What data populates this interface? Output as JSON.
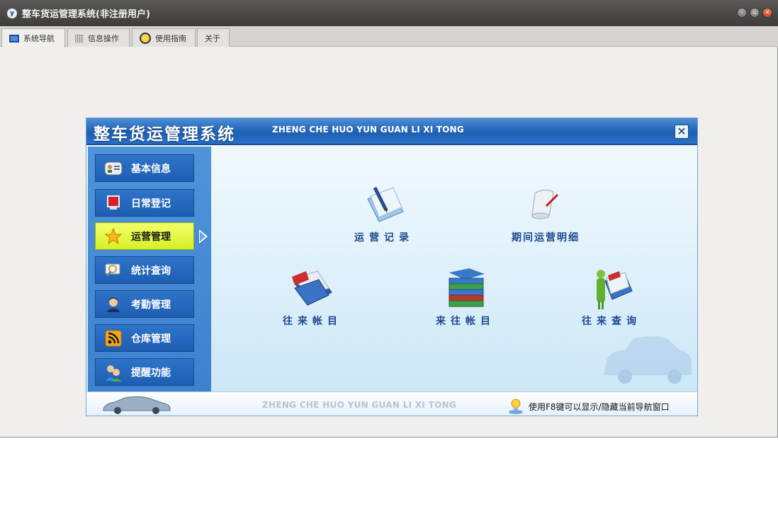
{
  "window": {
    "title": "整车货运管理系统(非注册用户)",
    "app_icon": "y"
  },
  "tabs": [
    {
      "label": "系统导航",
      "icon": "monitor-icon",
      "active": true
    },
    {
      "label": "信息操作",
      "icon": "grid-icon",
      "active": false
    },
    {
      "label": "使用指南",
      "icon": "help-icon",
      "active": false
    },
    {
      "label": "关于",
      "icon": "",
      "active": false
    }
  ],
  "nav": {
    "title": "整车货运管理系统",
    "subtitle": "ZHENG CHE HUO YUN GUAN LI XI TONG",
    "close_glyph": "✕",
    "sidebar": [
      {
        "label": "基本信息",
        "icon": "contact-card-icon",
        "active": false
      },
      {
        "label": "日常登记",
        "icon": "monitor-icon",
        "active": false
      },
      {
        "label": "运营管理",
        "icon": "star-icon",
        "active": true
      },
      {
        "label": "统计查询",
        "icon": "magnifier-icon",
        "active": false
      },
      {
        "label": "考勤管理",
        "icon": "user-icon",
        "active": false
      },
      {
        "label": "仓库管理",
        "icon": "rss-icon",
        "active": false
      },
      {
        "label": "提醒功能",
        "icon": "users-icon",
        "active": false
      }
    ],
    "functions": [
      {
        "label": "运营记录",
        "icon": "document-pen-icon"
      },
      {
        "label": "期间运营明细",
        "icon": "scroll-icon"
      },
      {
        "label": "往来帐目",
        "icon": "folder-icon"
      },
      {
        "label": "来往帐目",
        "icon": "books-icon"
      },
      {
        "label": "往来查询",
        "icon": "person-folder-icon"
      }
    ],
    "footer": {
      "subtitle": "ZHENG CHE HUO YUN GUAN LI XI TONG",
      "tip": "使用F8键可以显示/隐藏当前导航窗口"
    }
  },
  "colors": {
    "accent": "#1d5fb3",
    "active_item": "#e4f740",
    "label_blue": "#1b4a8e"
  }
}
